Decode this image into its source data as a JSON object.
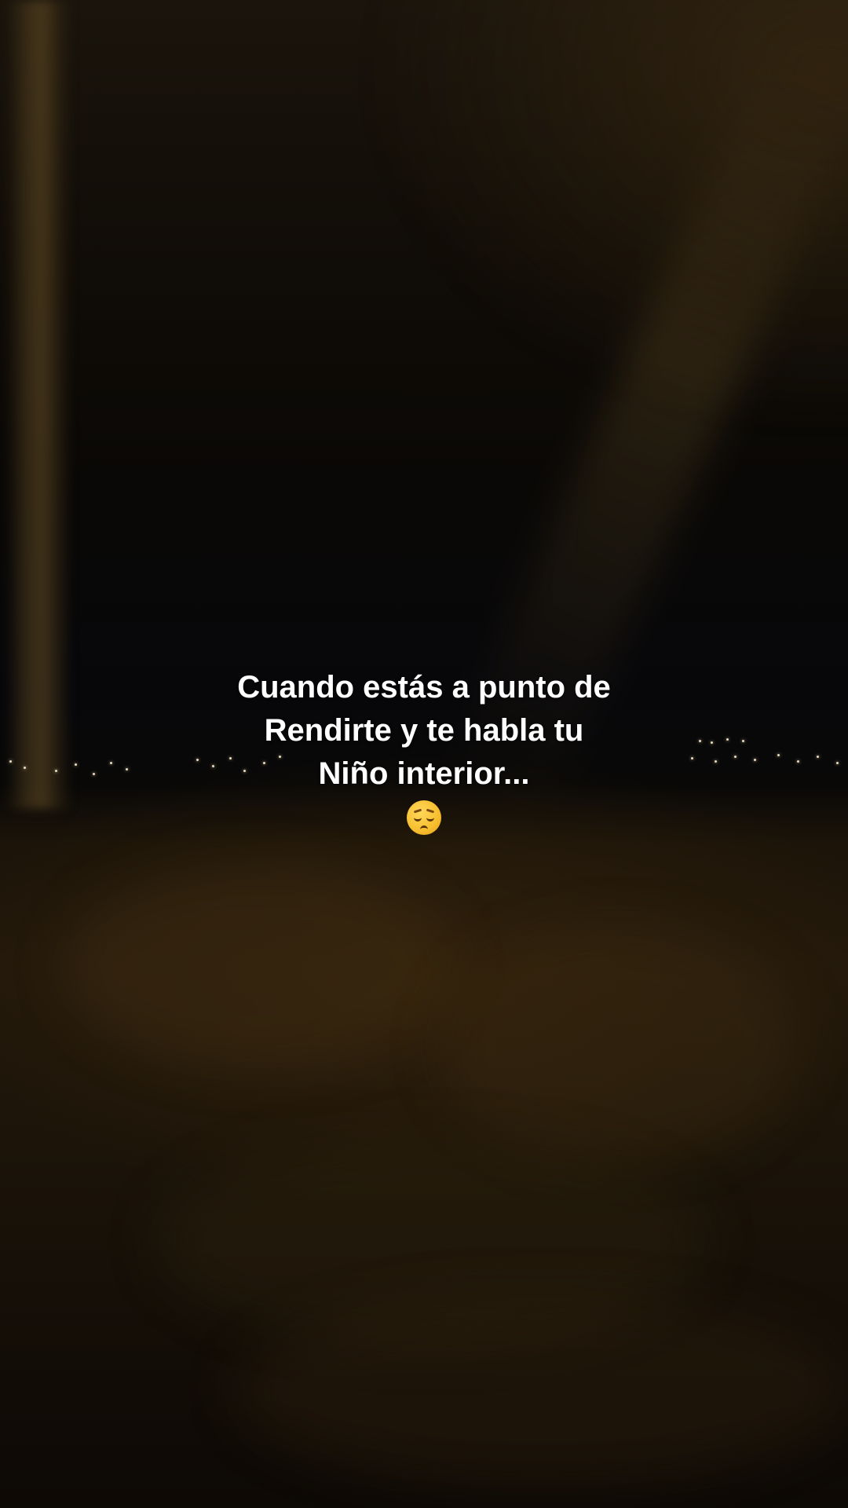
{
  "caption": {
    "line1": "Cuando estás a punto de",
    "line2": "Rendirte y te habla tu",
    "line3": "Niño interior...",
    "emoji": "pensive-face-emoji"
  },
  "colors": {
    "caption_text": "#ffffff",
    "sky": "#07070a",
    "ground": "#22180b",
    "lamp_glow": "#6e5228"
  }
}
